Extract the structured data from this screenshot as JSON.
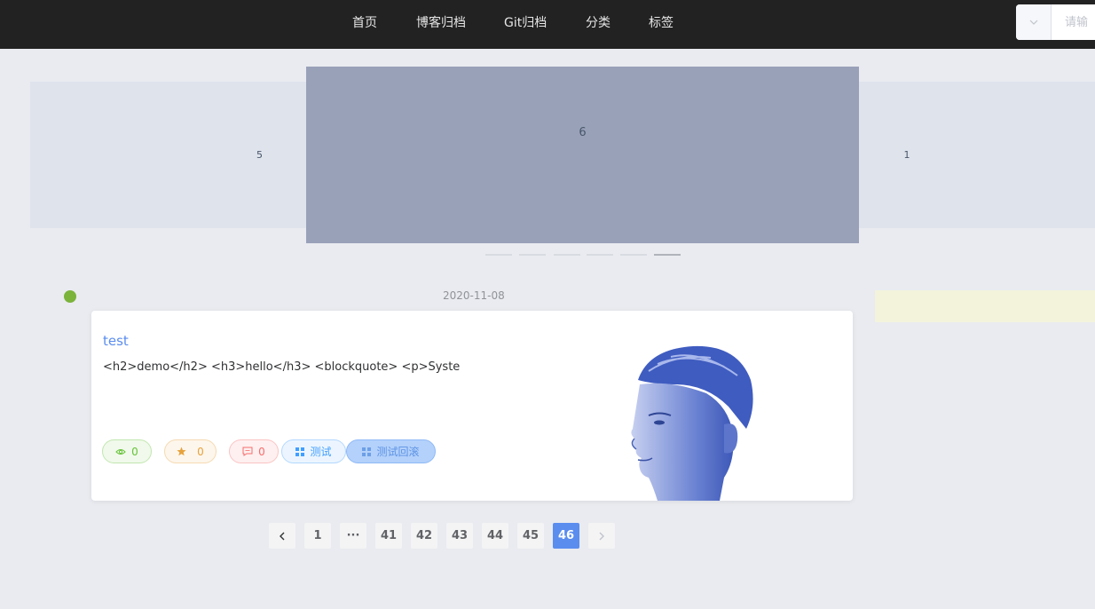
{
  "nav": {
    "items": [
      {
        "label": "首页"
      },
      {
        "label": "博客归档"
      },
      {
        "label": "Git归档"
      },
      {
        "label": "分类"
      },
      {
        "label": "标签"
      }
    ],
    "search_placeholder": "请输"
  },
  "carousel": {
    "left_label": "5",
    "active_label": "6",
    "right_label": "1",
    "indicator_count": 6,
    "active_index": 5
  },
  "post": {
    "date": "2020-11-08",
    "title": "test",
    "excerpt": "<h2>demo</h2> <h3>hello</h3> <blockquote> <p>Syste",
    "views": "0",
    "stars": "0",
    "comments": "0",
    "categories": [
      "测试",
      "测试回滚"
    ]
  },
  "pagination": {
    "pages": [
      "1",
      "···",
      "41",
      "42",
      "43",
      "44",
      "45",
      "46"
    ],
    "current": "46"
  },
  "colors": {
    "nav_bg": "#222222",
    "accent": "#5b8def",
    "timeline_dot": "#7bb33b"
  }
}
